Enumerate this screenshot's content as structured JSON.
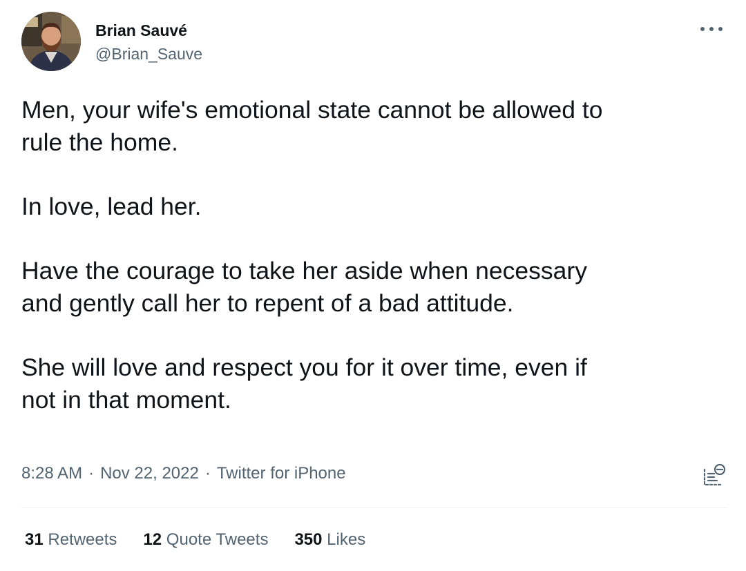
{
  "author": {
    "display_name": "Brian Sauvé",
    "handle": "@Brian_Sauve",
    "avatar_icon": "profile-photo"
  },
  "more_icon": "more-horizontal-icon",
  "tweet": {
    "paragraphs": [
      {
        "lines": [
          "Men, your wife's emotional state cannot be allowed to",
          "rule the home."
        ]
      },
      {
        "lines": [
          "In love, lead her."
        ]
      },
      {
        "lines": [
          "Have the courage to take her aside when necessary",
          "and gently call her to repent of a bad attitude."
        ]
      },
      {
        "lines": [
          "She will love and respect you for it over time, even if",
          "not in that moment."
        ]
      }
    ]
  },
  "meta": {
    "time": "8:28 AM",
    "separator": "·",
    "date": "Nov 22, 2022",
    "source": "Twitter for iPhone",
    "analytics_icon": "analytics-icon"
  },
  "stats": {
    "retweets": {
      "count": "31",
      "label": "Retweets"
    },
    "quote_tweets": {
      "count": "12",
      "label": "Quote Tweets"
    },
    "likes": {
      "count": "350",
      "label": "Likes"
    }
  },
  "colors": {
    "primary_text": "#0f1419",
    "secondary_text": "#536471",
    "divider": "#eff3f4"
  }
}
